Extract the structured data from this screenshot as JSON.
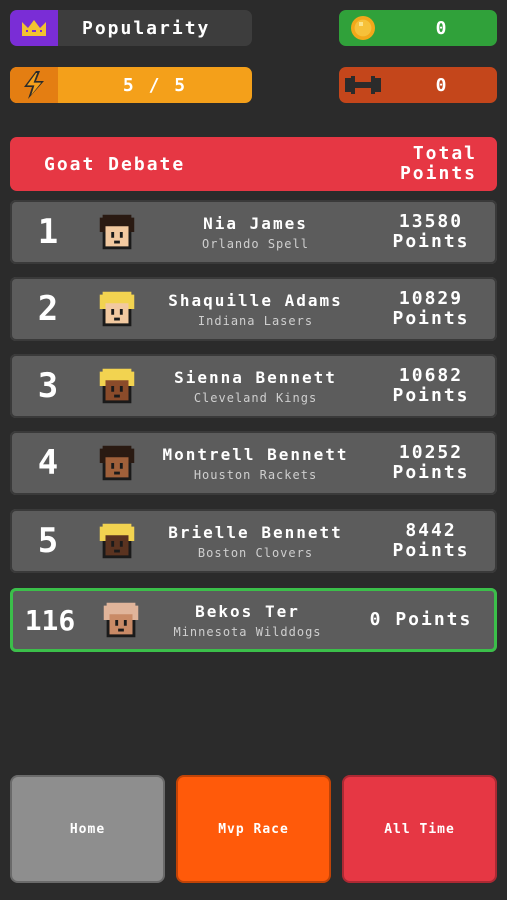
{
  "hud": {
    "popularity_label": "Popularity",
    "coins": "0",
    "energy": "5 / 5",
    "strength": "0",
    "icons": [
      "crown-icon",
      "coin-icon",
      "lightning-icon",
      "dumbbell-icon"
    ]
  },
  "leaderboard": {
    "title": "Goat Debate",
    "total_label": "Total Points",
    "rows": [
      {
        "rank": "1",
        "name": "Nia James",
        "team": "Orlando Spell",
        "points": "13580 Points",
        "hair": "#2a1a12",
        "skin": "#f2c9a0"
      },
      {
        "rank": "2",
        "name": "Shaquille Adams",
        "team": "Indiana Lasers",
        "points": "10829 Points",
        "hair": "#f2d350",
        "skin": "#f2c9a0"
      },
      {
        "rank": "3",
        "name": "Sienna Bennett",
        "team": "Cleveland Kings",
        "points": "10682 Points",
        "hair": "#f2d350",
        "skin": "#8a4b2a"
      },
      {
        "rank": "4",
        "name": "Montrell Bennett",
        "team": "Houston Rackets",
        "points": "10252 Points",
        "hair": "#2a1a12",
        "skin": "#a0603a"
      },
      {
        "rank": "5",
        "name": "Brielle Bennett",
        "team": "Boston Clovers",
        "points": "8442 Points",
        "hair": "#f2d350",
        "skin": "#5a3320"
      },
      {
        "rank": "116",
        "name": "Bekos Ter",
        "team": "Minnesota Wilddogs",
        "points": "0 Points",
        "hair": "#e0b49a",
        "skin": "#c98a66"
      }
    ]
  },
  "nav": {
    "home": "Home",
    "mvp_race": "Mvp Race",
    "all_time": "All Time"
  },
  "colors": {
    "background": "#2b2b2b",
    "header_red": "#e63744",
    "highlight_green": "#3bbf4a",
    "mvp_orange": "#ff5a0a"
  }
}
